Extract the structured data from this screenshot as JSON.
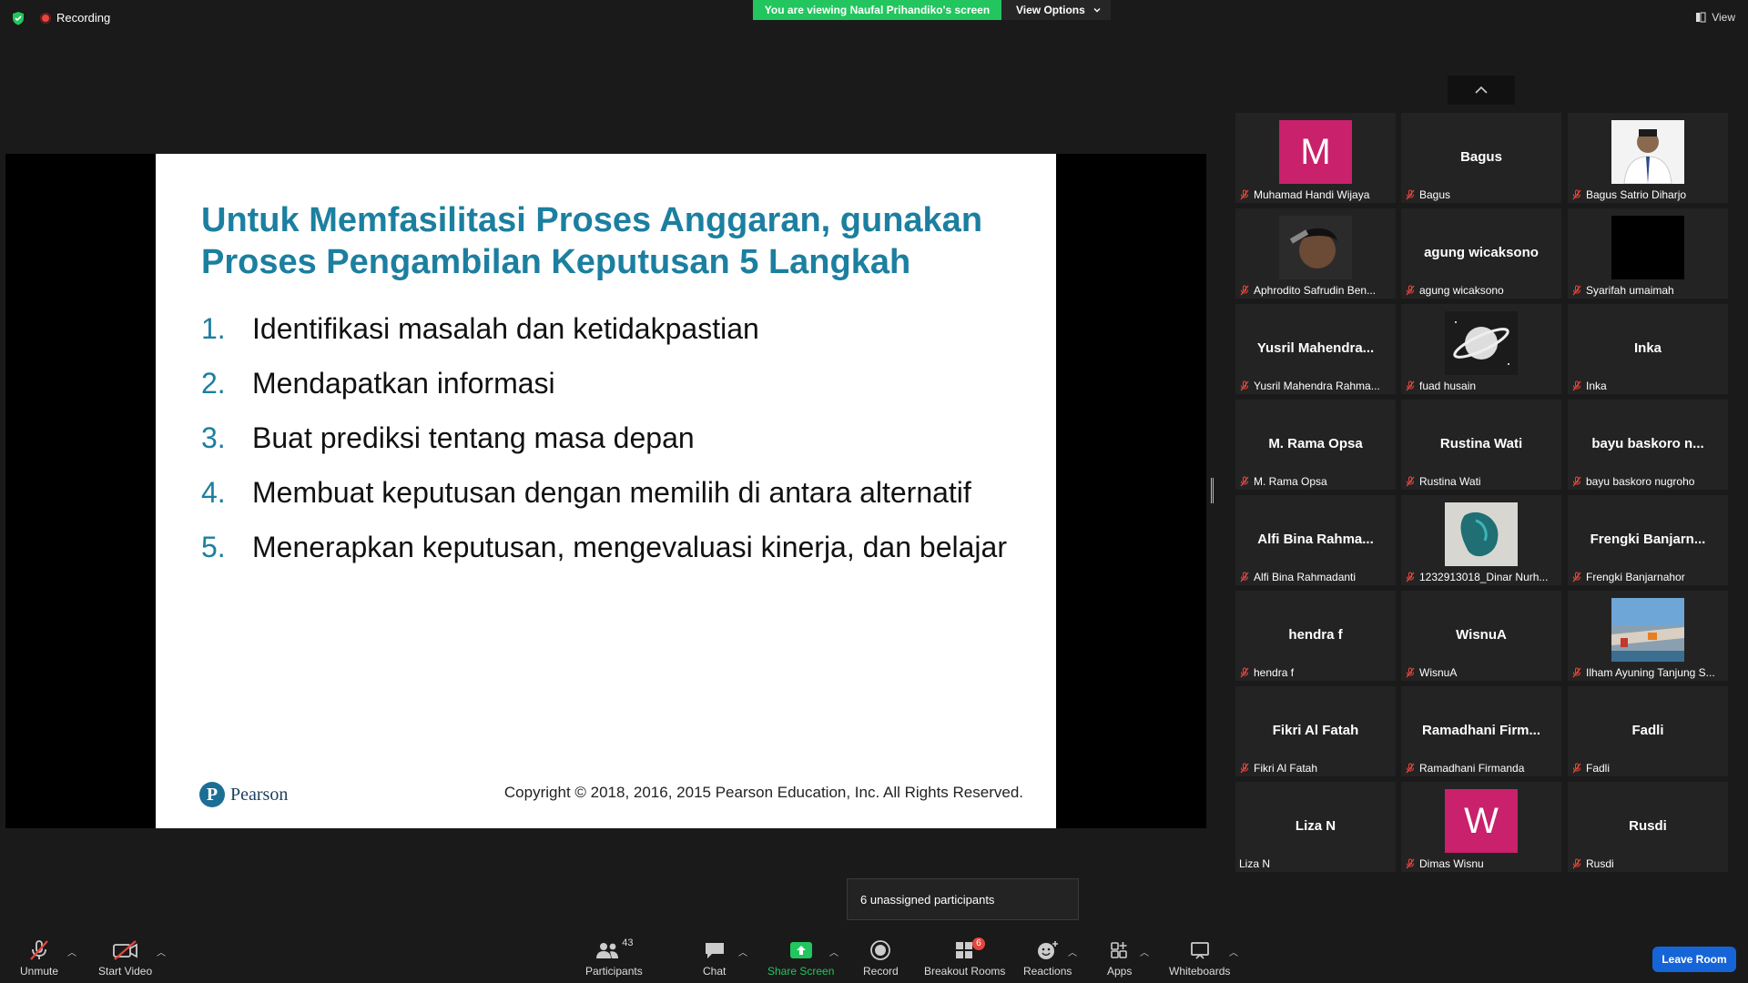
{
  "topbar": {
    "recording_label": "Recording",
    "viewing_banner": "You are viewing Naufal Prihandiko's screen",
    "view_options_label": "View Options",
    "view_label": "View"
  },
  "slide": {
    "title_line1": "Untuk Memfasilitasi Proses Anggaran, gunakan",
    "title_line2": "Proses Pengambilan Keputusan 5 Langkah",
    "items": [
      {
        "num": "1.",
        "text": "Identifikasi masalah dan ketidakpastian"
      },
      {
        "num": "2.",
        "text": "Mendapatkan informasi"
      },
      {
        "num": "3.",
        "text": "Buat prediksi tentang masa depan"
      },
      {
        "num": "4.",
        "text": "Membuat keputusan dengan memilih di antara alternatif"
      },
      {
        "num": "5.",
        "text": "Menerapkan keputusan, mengevaluasi kinerja, dan belajar"
      }
    ],
    "logo_text": "Pearson",
    "copyright": "Copyright © 2018, 2016, 2015 Pearson Education, Inc. All Rights Reserved."
  },
  "participants": [
    {
      "display": "M",
      "kind": "letter",
      "color": "#c9216b",
      "label": "Muhamad Handi Wijaya",
      "muted": true
    },
    {
      "display": "Bagus",
      "kind": "name",
      "label": "Bagus",
      "muted": true
    },
    {
      "display": "",
      "kind": "photo-person",
      "label": "Bagus Satrio Diharjo",
      "muted": true
    },
    {
      "display": "",
      "kind": "photo-dark",
      "label": "Aphrodito Safrudin Ben...",
      "muted": true
    },
    {
      "display": "agung wicaksono",
      "kind": "name",
      "label": "agung wicaksono",
      "muted": true
    },
    {
      "display": "",
      "kind": "photo-black",
      "label": "Syarifah umaimah",
      "muted": true
    },
    {
      "display": "Yusril  Mahendra...",
      "kind": "name",
      "label": "Yusril Mahendra Rahma...",
      "muted": true
    },
    {
      "display": "",
      "kind": "photo-planet",
      "label": "fuad husain",
      "muted": true
    },
    {
      "display": "Inka",
      "kind": "name",
      "label": "Inka",
      "muted": true
    },
    {
      "display": "M. Rama Opsa",
      "kind": "name",
      "label": "M. Rama Opsa",
      "muted": true
    },
    {
      "display": "Rustina Wati",
      "kind": "name",
      "label": "Rustina Wati",
      "muted": true
    },
    {
      "display": "bayu  baskoro  n...",
      "kind": "name",
      "label": "bayu baskoro nugroho",
      "muted": true
    },
    {
      "display": "Alfi Bina Rahma...",
      "kind": "name",
      "label": "Alfi Bina Rahmadanti",
      "muted": true
    },
    {
      "display": "",
      "kind": "photo-teal",
      "label": "1232913018_Dinar Nurh...",
      "muted": true
    },
    {
      "display": "Frengki  Banjarn...",
      "kind": "name",
      "label": "Frengki Banjarnahor",
      "muted": true
    },
    {
      "display": "hendra f",
      "kind": "name",
      "label": "hendra f",
      "muted": true
    },
    {
      "display": "WisnuA",
      "kind": "name",
      "label": "WisnuA",
      "muted": true
    },
    {
      "display": "",
      "kind": "photo-city",
      "label": "Ilham Ayuning Tanjung S...",
      "muted": true
    },
    {
      "display": "Fikri Al Fatah",
      "kind": "name",
      "label": "Fikri Al Fatah",
      "muted": true
    },
    {
      "display": "Ramadhani  Firm...",
      "kind": "name",
      "label": "Ramadhani Firmanda",
      "muted": true
    },
    {
      "display": "Fadli",
      "kind": "name",
      "label": "Fadli",
      "muted": true
    },
    {
      "display": "Liza N",
      "kind": "name",
      "label": "Liza N",
      "muted": false
    },
    {
      "display": "W",
      "kind": "letter",
      "color": "#c9216b",
      "label": "Dimas Wisnu",
      "muted": true
    },
    {
      "display": "Rusdi",
      "kind": "name",
      "label": "Rusdi",
      "muted": true
    }
  ],
  "popup": {
    "unassigned": "6 unassigned participants"
  },
  "toolbar": {
    "unmute": "Unmute",
    "start_video": "Start Video",
    "participants": "Participants",
    "participants_count": "43",
    "chat": "Chat",
    "share_screen": "Share Screen",
    "record": "Record",
    "breakout_rooms": "Breakout Rooms",
    "breakout_badge": "6",
    "reactions": "Reactions",
    "apps": "Apps",
    "whiteboards": "Whiteboards",
    "leave_room": "Leave Room"
  },
  "colors": {
    "accent_green": "#22c55e",
    "slide_title_blue": "#1c7fa0",
    "avatar_pink": "#c9216b",
    "leave_blue": "#1565d8",
    "muted_red": "#e8453c"
  }
}
